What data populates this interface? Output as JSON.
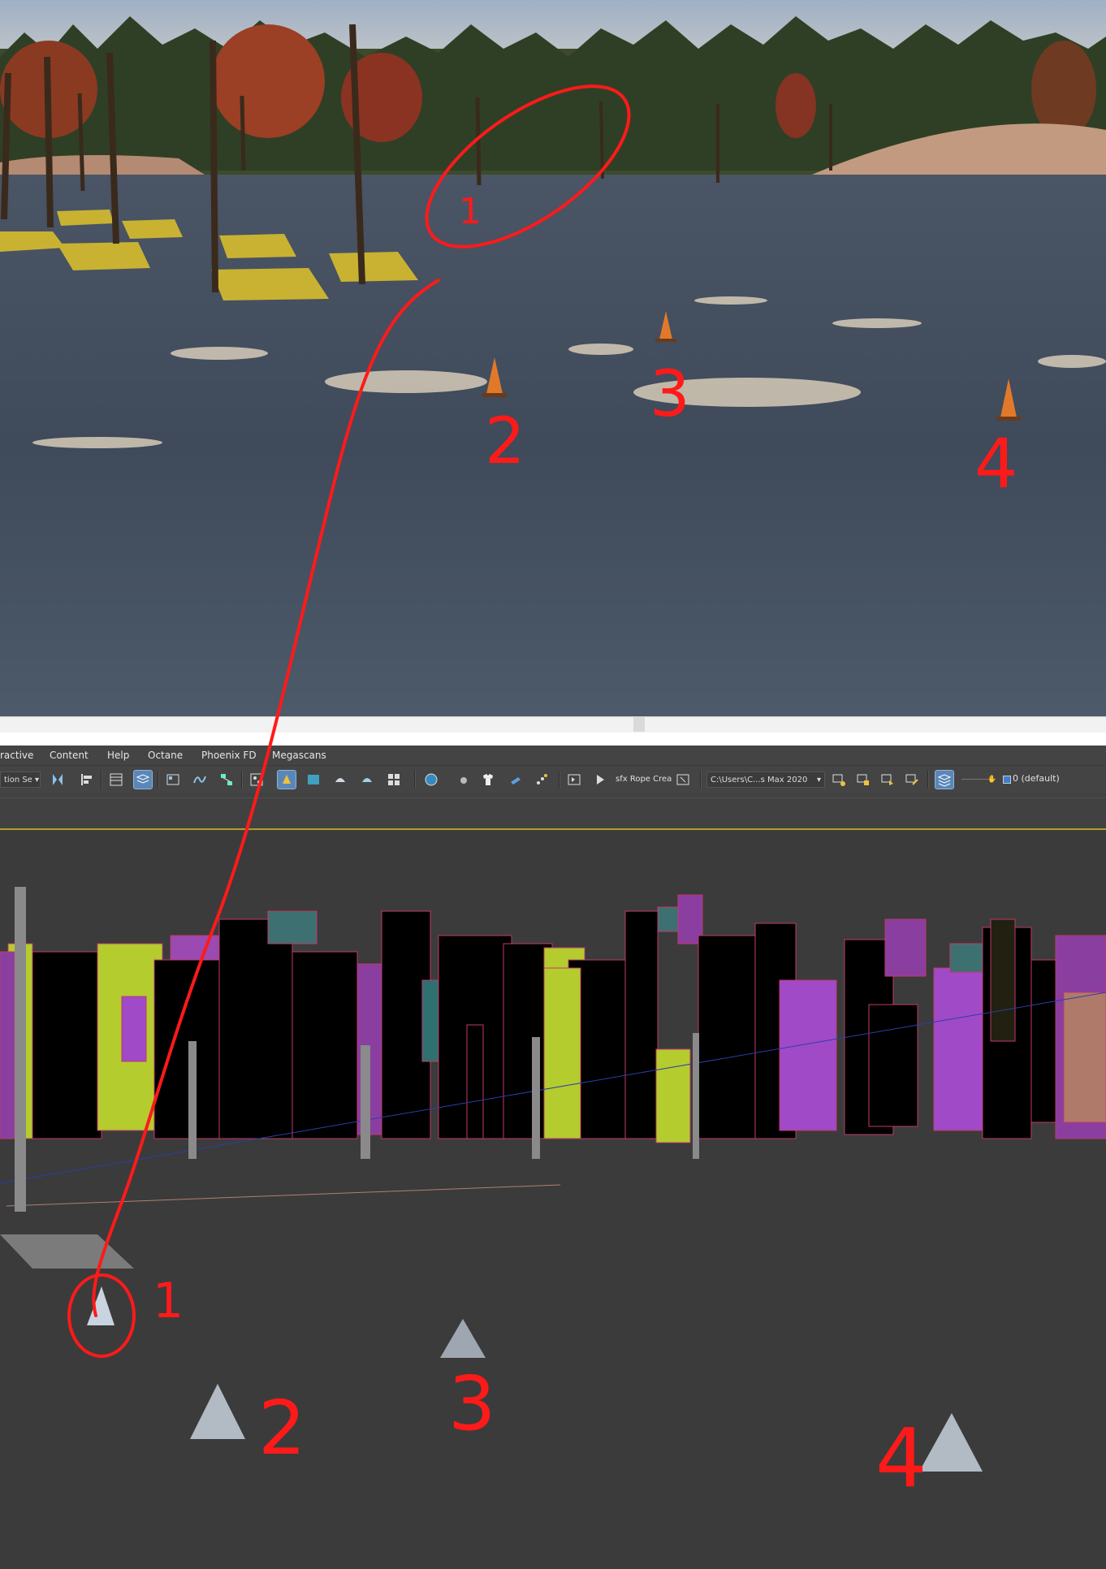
{
  "menu": {
    "items": [
      "ractive",
      "Content",
      "Help",
      "Octane",
      "Phoenix FD",
      "Megascans"
    ]
  },
  "toolbar": {
    "selection_set_value": "tion Se",
    "rope_tool_label": "sfx Rope Crea",
    "project_path": "C:\\Users\\C...s Max 2020",
    "layer_value": "0 (default)"
  },
  "annotations": {
    "render": [
      "1",
      "2",
      "3",
      "4"
    ],
    "viewport": [
      "1",
      "2",
      "3",
      "4"
    ]
  },
  "colors": {
    "annotation": "#ff1a1a",
    "accent_active": "#5b87b8",
    "ribbon_line": "#b49b2a",
    "viewport_bg": "#3b3b3b"
  },
  "icons": [
    "selection-filter-icon",
    "mirror-icon",
    "align-icon",
    "scene-explorer-icon",
    "layer-explorer-icon",
    "toggle-ribbon-icon",
    "curve-editor-icon",
    "schematic-view-icon",
    "material-editor-icon",
    "render-setup-icon",
    "rendered-frame-icon",
    "render-icon",
    "render-iterative-icon",
    "render-online-icon",
    "environment-icon",
    "sphere-icon",
    "cloth-icon",
    "hair-icon",
    "particle-icon",
    "rope-icon",
    "layer-manager-icon"
  ]
}
